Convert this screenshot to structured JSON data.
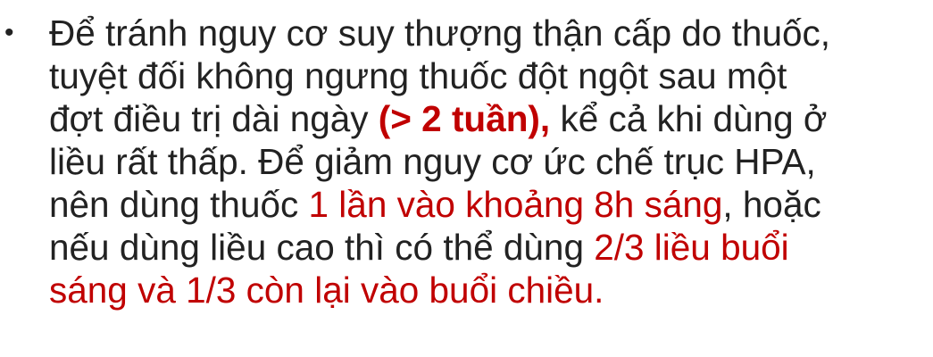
{
  "bullet": {
    "marker": "•",
    "lines": [
      {
        "s1": "Để tránh nguy cơ suy thượng thận cấp do thuốc,"
      },
      {
        "s1": "tuyệt đối không ngưng thuốc đột ngột sau một"
      },
      {
        "s1": "đợt điều trị dài ngày ",
        "s2": "(> 2 tuần),",
        "s3": " kể cả khi dùng ở"
      },
      {
        "s1": "liều rất thấp. Để giảm nguy cơ ức chế trục HPA,"
      },
      {
        "s1": "nên dùng thuốc ",
        "s2": "1 lần vào khoảng 8h sáng",
        "s3": ", hoặc"
      },
      {
        "s1": "nếu dùng liều cao thì có thể dùng ",
        "s2": "2/3 liều buổi"
      },
      {
        "s2": "sáng và 1/3 còn lại vào buổi chiều."
      }
    ]
  },
  "colors": {
    "text": "#222222",
    "highlight": "#c00000",
    "background": "#ffffff"
  }
}
